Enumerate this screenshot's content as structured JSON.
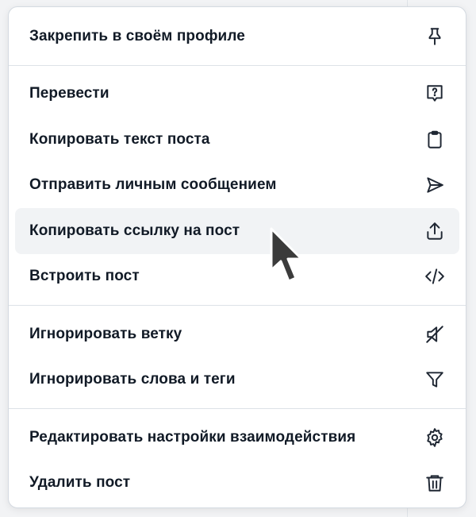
{
  "menu": {
    "items": [
      {
        "id": "pin-profile",
        "label": "Закрепить в своём профиле",
        "icon": "pin-icon"
      },
      {
        "id": "translate",
        "label": "Перевести",
        "icon": "translate-icon"
      },
      {
        "id": "copy-text",
        "label": "Копировать текст поста",
        "icon": "clipboard-icon"
      },
      {
        "id": "send-dm",
        "label": "Отправить личным сообщением",
        "icon": "send-icon"
      },
      {
        "id": "copy-link",
        "label": "Копировать ссылку на пост",
        "icon": "share-icon"
      },
      {
        "id": "embed",
        "label": "Встроить пост",
        "icon": "code-icon"
      },
      {
        "id": "mute-thread",
        "label": "Игнорировать ветку",
        "icon": "muted-speaker-icon"
      },
      {
        "id": "mute-words",
        "label": "Игнорировать слова и теги",
        "icon": "filter-icon"
      },
      {
        "id": "interaction-settings",
        "label": "Редактировать настройки взаимодействия",
        "icon": "gear-icon"
      },
      {
        "id": "delete",
        "label": "Удалить пост",
        "icon": "trash-icon"
      }
    ]
  },
  "colors": {
    "text": "#111a26",
    "icon": "#1f2733",
    "hover_bg": "#f1f3f5",
    "divider": "#dde2e7"
  }
}
